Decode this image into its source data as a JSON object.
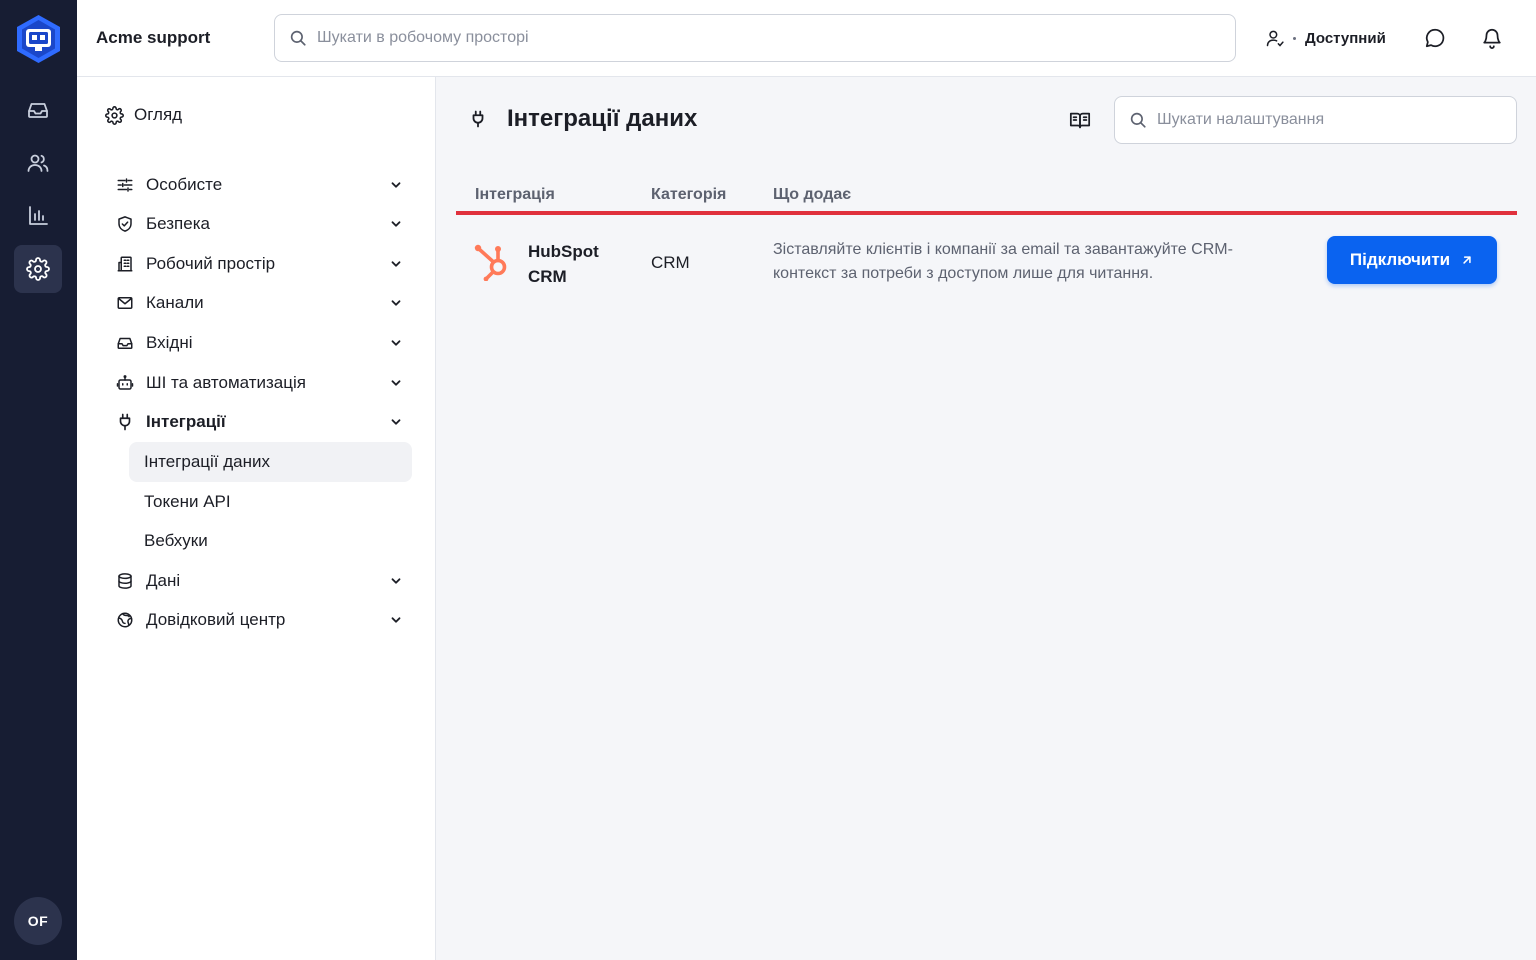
{
  "app": {
    "workspace_name": "Acme support",
    "global_search_placeholder": "Шукати в робочому просторі",
    "status_label": "Доступний",
    "avatar_initials": "OF",
    "accent_color": "#0a63f0",
    "rail_items": [
      "inbox-icon",
      "users-icon",
      "reports-icon",
      "settings-icon"
    ],
    "active_rail_item": "settings-icon"
  },
  "settings_nav": {
    "overview_label": "Огляд",
    "sections": [
      {
        "label": "Особисте",
        "icon": "sliders-icon"
      },
      {
        "label": "Безпека",
        "icon": "shield-icon"
      },
      {
        "label": "Робочий простір",
        "icon": "building-icon"
      },
      {
        "label": "Канали",
        "icon": "mail-icon"
      },
      {
        "label": "Вхідні",
        "icon": "inbox-icon"
      },
      {
        "label": "ШІ та автоматизація",
        "icon": "bot-icon"
      },
      {
        "label": "Інтеграції",
        "icon": "plug-icon",
        "expanded": true
      },
      {
        "label": "Дані",
        "icon": "database-icon"
      },
      {
        "label": "Довідковий центр",
        "icon": "globe-icon"
      }
    ],
    "integrations_subitems": [
      {
        "label": "Інтеграції даних",
        "active": true
      },
      {
        "label": "Токени API"
      },
      {
        "label": "Вебхуки"
      }
    ]
  },
  "page": {
    "title": "Інтеграції даних",
    "search_placeholder": "Шукати налаштування",
    "table": {
      "headers": [
        "Інтеграція",
        "Категорія",
        "Що додає"
      ],
      "rows": [
        {
          "name": "HubSpot CRM",
          "category": "CRM",
          "description": "Зіставляйте клієнтів і компанії за email та завантажуйте CRM-контекст за потреби з доступом лише для читання.",
          "action": "Підключити",
          "logo_color": "#ff7a59"
        }
      ]
    }
  }
}
